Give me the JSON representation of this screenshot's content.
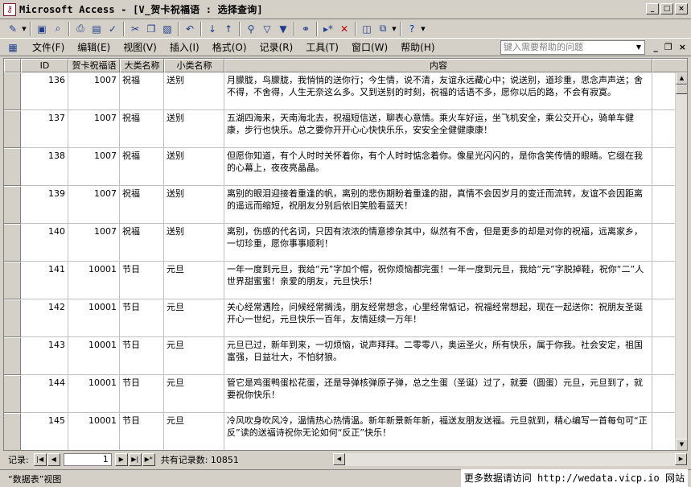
{
  "window": {
    "title": "Microsoft Access - [V_贺卡祝福语 : 选择查询]",
    "controls": [
      "_",
      "□",
      "×"
    ]
  },
  "toolbar_icons": [
    "view-icon",
    "save-icon",
    "search-icon",
    "print-icon",
    "print-preview-icon",
    "spell-icon",
    "cut-icon",
    "copy-icon",
    "paste-icon",
    "undo-icon",
    "sort-asc-icon",
    "sort-desc-icon",
    "filter-selection-icon",
    "filter-form-icon",
    "apply-filter-icon",
    "find-icon",
    "new-record-icon",
    "delete-record-icon",
    "database-window-icon",
    "new-object-icon",
    "help-icon"
  ],
  "menu": {
    "items": [
      "文件(F)",
      "编辑(E)",
      "视图(V)",
      "插入(I)",
      "格式(O)",
      "记录(R)",
      "工具(T)",
      "窗口(W)",
      "帮助(H)"
    ],
    "help_placeholder": "键入需要帮助的问题"
  },
  "columns": [
    "ID",
    "贺卡祝福语",
    "大类名称",
    "小类名称",
    "内容"
  ],
  "rows": [
    {
      "id": "136",
      "hk": "1007",
      "dl": "祝福",
      "xl": "送别",
      "nr": "月朦胧，鸟朦胧，我悄悄的送你行；今生情，说不清，友谊永远藏心中；说送别，道珍重，思念声声送；舍不得，不舍得，人生无奈这么多。又到送别的时刻，祝福的话语不多，愿你以后的路，不会有寂寞。"
    },
    {
      "id": "137",
      "hk": "1007",
      "dl": "祝福",
      "xl": "送别",
      "nr": "五湖四海来，天南海北去，祝福短信送，聊表心意情。乘火车好运，坐飞机安全，乘公交开心，骑单车健康，步行也快乐。总之要你开开心心快快乐乐，安安全全健健康康！"
    },
    {
      "id": "138",
      "hk": "1007",
      "dl": "祝福",
      "xl": "送别",
      "nr": "但愿你知道，有个人时时关怀着你，有个人时时惦念着你。像星光闪闪的，是你含笑传情的眼睛。它缀在我的心幕上，夜夜亮晶晶。"
    },
    {
      "id": "139",
      "hk": "1007",
      "dl": "祝福",
      "xl": "送别",
      "nr": "离别的眼泪迎接着重逢的帆，离别的悲伤期盼着重逢的甜，真情不会因岁月的变迁而流转，友谊不会因距离的遥远而缩短，祝朋友分别后依旧笑脸看蓝天！"
    },
    {
      "id": "140",
      "hk": "1007",
      "dl": "祝福",
      "xl": "送别",
      "nr": "离别，伤感的代名词，只因有浓浓的情意掺杂其中，纵然有不舍，但是更多的却是对你的祝福，远离家乡，一切珍重，愿你事事顺利！"
    },
    {
      "id": "141",
      "hk": "10001",
      "dl": "节日",
      "xl": "元旦",
      "nr": "一年一度到元旦，我给“元”字加个帽，祝你烦恼都完蛋！一年一度到元旦，我给“元”字脱掉鞋，祝你“二”人世界甜蜜蜜！亲爱的朋友，元旦快乐！"
    },
    {
      "id": "142",
      "hk": "10001",
      "dl": "节日",
      "xl": "元旦",
      "nr": "关心经常遇险，问候经常搁浅，朋友经常想念，心里经常惦记，祝福经常想起，现在一起送你：祝朋友圣诞开心一世纪，元旦快乐一百年，友情延续一万年！"
    },
    {
      "id": "143",
      "hk": "10001",
      "dl": "节日",
      "xl": "元旦",
      "nr": "元旦已过，新年到来，一切烦恼，说声拜拜。二零零八，奥运圣火，所有快乐，属于你我。社会安定，祖国富强，日益壮大，不怕豺狼。"
    },
    {
      "id": "144",
      "hk": "10001",
      "dl": "节日",
      "xl": "元旦",
      "nr": "管它是鸡蛋鸭蛋松花蛋，还是导弹核弹原子弹，总之生蛋（圣诞）过了，就要（圆蛋）元旦，元旦到了，就要祝你快乐！"
    },
    {
      "id": "145",
      "hk": "10001",
      "dl": "节日",
      "xl": "元旦",
      "nr": "冷风吹身吹风冷，温情热心热情温。新年新景新年新，福送友朋友送福。元旦就到，精心编写一首每句可“正反”读的送福诗祝你无论如何“反正”快乐！"
    }
  ],
  "nav": {
    "label": "记录:",
    "current": "1",
    "count_text": "共有记录数: 10851",
    "buttons": [
      "|◀",
      "◀",
      "▶",
      "▶|",
      "▶*"
    ]
  },
  "status": {
    "view": "“数据表”视图"
  },
  "watermark": "更多数据请访问 http://wedata.vicp.io 网站"
}
